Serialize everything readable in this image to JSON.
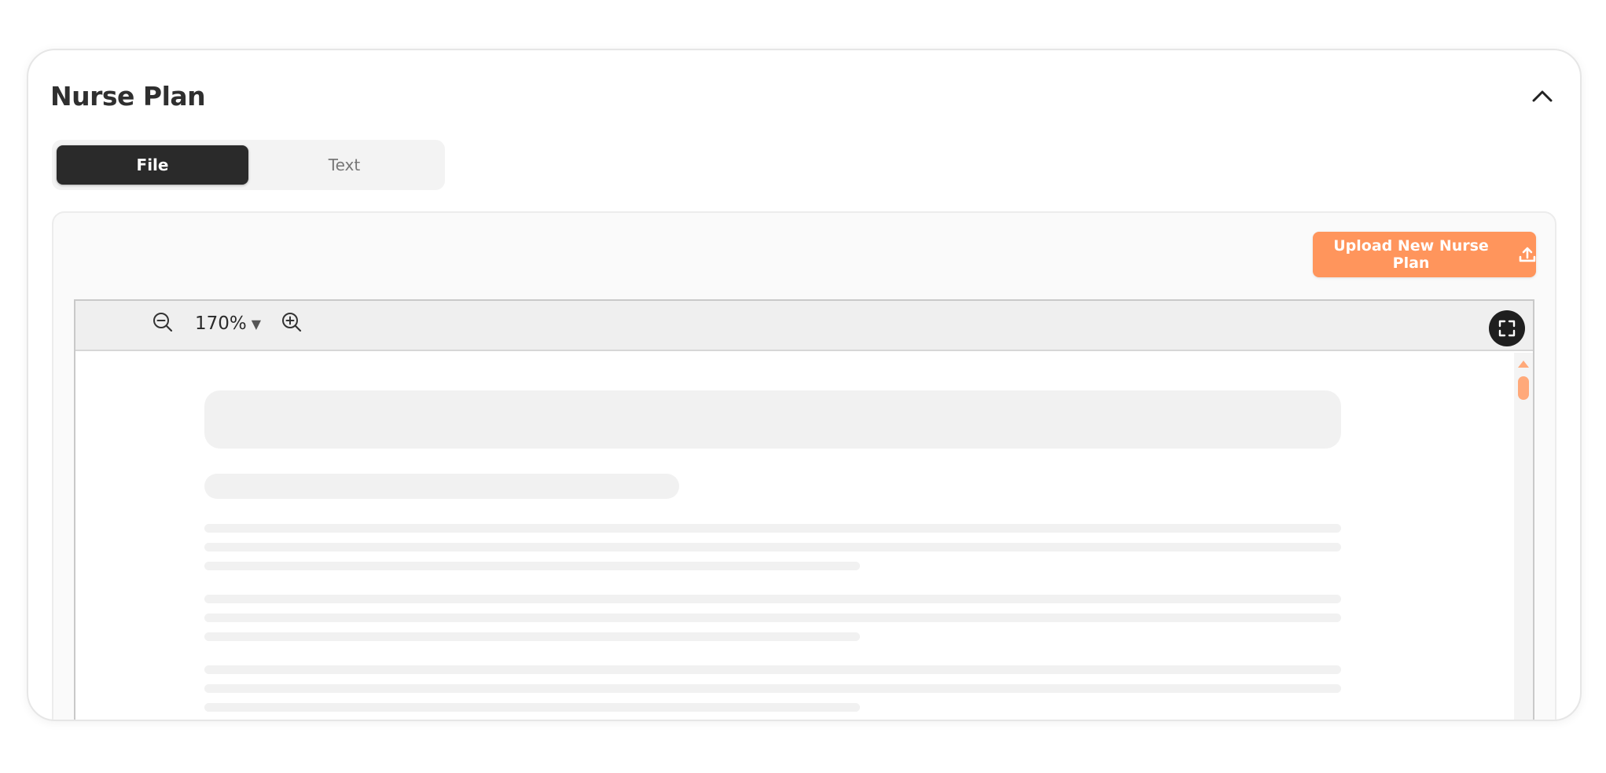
{
  "card": {
    "title": "Nurse Plan"
  },
  "tabs": [
    {
      "label": "File",
      "active": true
    },
    {
      "label": "Text",
      "active": false
    }
  ],
  "upload": {
    "label": "Upload New Nurse Plan",
    "icon": "upload-icon"
  },
  "viewer": {
    "zoom_level": "170%",
    "zoom_caret": "▼",
    "icons": {
      "zoom_out": "zoom-out-icon",
      "zoom_in": "zoom-in-icon",
      "fullscreen": "fullscreen-icon",
      "collapse": "chevron-up-icon"
    }
  },
  "colors": {
    "accent": "#ff955c",
    "tab_active_bg": "#2a2a2a",
    "scroll_accent": "#ffa97a"
  }
}
